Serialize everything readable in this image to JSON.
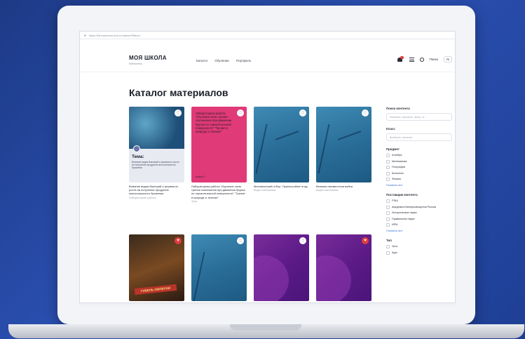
{
  "browser": {
    "url": "https://lib.myschool.edu.ru/market?filters="
  },
  "header": {
    "logo_main": "МОЯ ШКОЛА",
    "logo_sub": "библиотека",
    "nav": [
      "Каталог",
      "Обучение",
      "Портфель"
    ],
    "search_label": "Поиск",
    "lang": "РБ"
  },
  "page": {
    "title": "Каталог материалов"
  },
  "cards": [
    {
      "theme": "Тема:",
      "theme_text": "Влияние видов бактерий и режима их роста на получение продуктов молочнокислого брожения",
      "title": "Влияние видов бактерий и режима их роста на получение продуктов молочнокислого брожения",
      "type": "Лабораторная работа"
    },
    {
      "cover_text": "Лабораторная работа \"Изучение силы трения скольжения при движении бруска по горизонтальной поверхности\" \"Трение в природе и технике\"",
      "grade": "Класс 7",
      "title": "Лабораторная работа \"Изучение силы трения скольжения при движении бруска по горизонтальной поверхности\" \"Трение в природе и технике\"",
      "type": "Урок"
    },
    {
      "title": "Механический отбор. Приспособлен в ад.",
      "type": "Видео материалы"
    },
    {
      "title": "Великая неизвестная война",
      "type": "Видео материалы"
    },
    {
      "cover_text": "ГИБЕЛЬ ИМПЕРИИ",
      "title": "",
      "type": ""
    },
    {
      "title": "",
      "type": ""
    },
    {
      "title": "",
      "type": ""
    },
    {
      "title": "",
      "type": ""
    }
  ],
  "sidebar": {
    "search_heading": "Поиск контента",
    "search_placeholder": "Название, описание, автор, те...",
    "class_heading": "Класс",
    "class_placeholder": "Выберите значение",
    "subject_heading": "Предмет",
    "subjects": [
      "Алгебра",
      "Математика",
      "География",
      "Биология",
      "Физика"
    ],
    "show_all": "Показать все",
    "providers_heading": "Поставщик контента",
    "providers": [
      "РЭШ",
      "Академия Минпросвещения России",
      "Исторические парки",
      "Правильная наука",
      "ИРМ"
    ],
    "show_all_2": "Показать все",
    "type_heading": "Тип",
    "types": [
      "Урок",
      "Курс"
    ]
  },
  "colors": {
    "background": "#1f3f95",
    "accent_red": "#e23b3b",
    "pink": "#e03a78",
    "link": "#3a6fd8"
  }
}
